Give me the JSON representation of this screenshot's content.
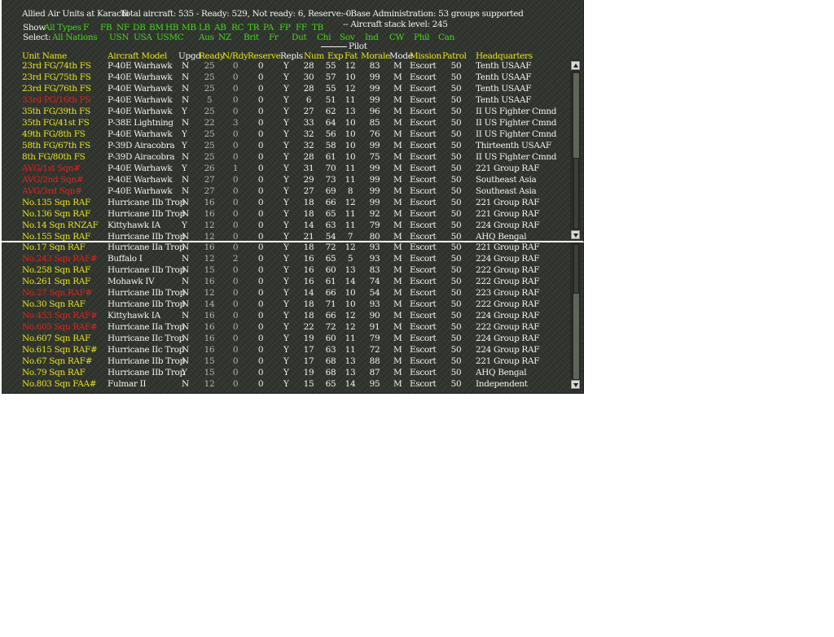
{
  "summary": {
    "title": "Allied Air Units at Karachi",
    "totals": "Total aircraft: 535 - Ready: 529, Not ready: 6, Reserve: 0",
    "base_admin": "-- Base Administration: 53 groups supported",
    "stack_level": "-- Aircraft stack level: 245"
  },
  "filters": {
    "show_label": "Show",
    "all_types": "All Types",
    "types": [
      "F",
      "FB",
      "NF",
      "DB",
      "BM",
      "HB",
      "MB",
      "LB",
      "AB",
      "RC",
      "TR",
      "PA",
      "FP",
      "FF",
      "TB"
    ],
    "select_label": "Select:",
    "all_nations": "All Nations",
    "nations": [
      "USN",
      "USA",
      "USMC",
      "Aus",
      "NZ",
      "Brit",
      "Fr",
      "Dut",
      "Chi",
      "Sov",
      "Ind",
      "CW",
      "Phil",
      "Can"
    ]
  },
  "headers": {
    "pilot": "Pilot",
    "unit": "Unit Name",
    "model": "Aircraft Model",
    "upgd": "Upgd",
    "ready": "Ready",
    "nrdy": "N/Rdy",
    "reserve": "Reserve",
    "repls": "Repls",
    "num": "Num",
    "exp": "Exp",
    "fat": "Fat",
    "morale": "Morale",
    "mode": "Mode",
    "mission": "Mission",
    "patrol": "Patrol",
    "hq": "Headquarters"
  },
  "colors": {
    "panel_bg": "#2f332c",
    "text_white": "#f2f2f2",
    "text_green": "#42d81a",
    "text_yellow": "#e7e41d",
    "text_red": "#e8201c"
  },
  "rows_top": [
    {
      "unit": "23rd FG/74th FS",
      "color": "yellow",
      "model": "P-40E Warhawk",
      "upgd": "N",
      "ready": "25",
      "nrdy": "0",
      "reserve": "0",
      "repls": "Y",
      "num": "28",
      "exp": "55",
      "fat": "12",
      "morale": "83",
      "mode": "M",
      "mission": "Escort",
      "patrol": "50",
      "hq": "Tenth USAAF"
    },
    {
      "unit": "23rd FG/75th FS",
      "color": "yellow",
      "model": "P-40E Warhawk",
      "upgd": "N",
      "ready": "25",
      "nrdy": "0",
      "reserve": "0",
      "repls": "Y",
      "num": "30",
      "exp": "57",
      "fat": "10",
      "morale": "99",
      "mode": "M",
      "mission": "Escort",
      "patrol": "50",
      "hq": "Tenth USAAF"
    },
    {
      "unit": "23rd FG/76th FS",
      "color": "yellow",
      "model": "P-40E Warhawk",
      "upgd": "N",
      "ready": "25",
      "nrdy": "0",
      "reserve": "0",
      "repls": "Y",
      "num": "28",
      "exp": "55",
      "fat": "12",
      "morale": "99",
      "mode": "M",
      "mission": "Escort",
      "patrol": "50",
      "hq": "Tenth USAAF"
    },
    {
      "unit": "33rd PG/16th FS",
      "color": "red",
      "model": "P-40E Warhawk",
      "upgd": "N",
      "ready": "5",
      "nrdy": "0",
      "reserve": "0",
      "repls": "Y",
      "num": "6",
      "exp": "51",
      "fat": "11",
      "morale": "99",
      "mode": "M",
      "mission": "Escort",
      "patrol": "50",
      "hq": "Tenth USAAF"
    },
    {
      "unit": "35th FG/39th FS",
      "color": "yellow",
      "model": "P-40E Warhawk",
      "upgd": "Y",
      "ready": "25",
      "nrdy": "0",
      "reserve": "0",
      "repls": "Y",
      "num": "27",
      "exp": "62",
      "fat": "13",
      "morale": "96",
      "mode": "M",
      "mission": "Escort",
      "patrol": "50",
      "hq": "II US Fighter Cmnd"
    },
    {
      "unit": "35th FG/41st FS",
      "color": "yellow",
      "model": "P-38E Lightning",
      "upgd": "N",
      "ready": "22",
      "nrdy": "3",
      "reserve": "0",
      "repls": "Y",
      "num": "33",
      "exp": "64",
      "fat": "10",
      "morale": "85",
      "mode": "M",
      "mission": "Escort",
      "patrol": "50",
      "hq": "II US Fighter Cmnd"
    },
    {
      "unit": "49th FG/8th FS",
      "color": "yellow",
      "model": "P-40E Warhawk",
      "upgd": "Y",
      "ready": "25",
      "nrdy": "0",
      "reserve": "0",
      "repls": "Y",
      "num": "32",
      "exp": "56",
      "fat": "10",
      "morale": "76",
      "mode": "M",
      "mission": "Escort",
      "patrol": "50",
      "hq": "II US Fighter Cmnd"
    },
    {
      "unit": "58th FG/67th FS",
      "color": "yellow",
      "model": "P-39D Airacobra",
      "upgd": "Y",
      "ready": "25",
      "nrdy": "0",
      "reserve": "0",
      "repls": "Y",
      "num": "32",
      "exp": "58",
      "fat": "10",
      "morale": "99",
      "mode": "M",
      "mission": "Escort",
      "patrol": "50",
      "hq": "Thirteenth USAAF"
    },
    {
      "unit": "8th FG/80th FS",
      "color": "yellow",
      "model": "P-39D Airacobra",
      "upgd": "N",
      "ready": "25",
      "nrdy": "0",
      "reserve": "0",
      "repls": "Y",
      "num": "28",
      "exp": "61",
      "fat": "10",
      "morale": "75",
      "mode": "M",
      "mission": "Escort",
      "patrol": "50",
      "hq": "II US Fighter Cmnd"
    },
    {
      "unit": "AVG/1st Sqn#",
      "color": "red",
      "model": "P-40E Warhawk",
      "upgd": "Y",
      "ready": "26",
      "nrdy": "1",
      "reserve": "0",
      "repls": "Y",
      "num": "31",
      "exp": "70",
      "fat": "11",
      "morale": "99",
      "mode": "M",
      "mission": "Escort",
      "patrol": "50",
      "hq": "221 Group RAF"
    },
    {
      "unit": "AVG/2nd Sqn#",
      "color": "red",
      "model": "P-40E Warhawk",
      "upgd": "N",
      "ready": "27",
      "nrdy": "0",
      "reserve": "0",
      "repls": "Y",
      "num": "29",
      "exp": "73",
      "fat": "11",
      "morale": "99",
      "mode": "M",
      "mission": "Escort",
      "patrol": "50",
      "hq": "Southeast Asia"
    },
    {
      "unit": "AVG/3rd Sqn#",
      "color": "red",
      "model": "P-40E Warhawk",
      "upgd": "N",
      "ready": "27",
      "nrdy": "0",
      "reserve": "0",
      "repls": "Y",
      "num": "27",
      "exp": "69",
      "fat": "8",
      "morale": "99",
      "mode": "M",
      "mission": "Escort",
      "patrol": "50",
      "hq": "Southeast Asia"
    },
    {
      "unit": "No.135 Sqn RAF",
      "color": "yellow",
      "model": "Hurricane IIb Trop",
      "upgd": "N",
      "ready": "16",
      "nrdy": "0",
      "reserve": "0",
      "repls": "Y",
      "num": "18",
      "exp": "66",
      "fat": "12",
      "morale": "99",
      "mode": "M",
      "mission": "Escort",
      "patrol": "50",
      "hq": "221 Group RAF"
    },
    {
      "unit": "No.136 Sqn RAF",
      "color": "yellow",
      "model": "Hurricane IIb Trop",
      "upgd": "N",
      "ready": "16",
      "nrdy": "0",
      "reserve": "0",
      "repls": "Y",
      "num": "18",
      "exp": "65",
      "fat": "11",
      "morale": "92",
      "mode": "M",
      "mission": "Escort",
      "patrol": "50",
      "hq": "221 Group RAF"
    },
    {
      "unit": "No.14 Sqn RNZAF",
      "color": "yellow",
      "model": "Kittyhawk IA",
      "upgd": "Y",
      "ready": "12",
      "nrdy": "0",
      "reserve": "0",
      "repls": "Y",
      "num": "14",
      "exp": "63",
      "fat": "11",
      "morale": "79",
      "mode": "M",
      "mission": "Escort",
      "patrol": "50",
      "hq": "224 Group RAF"
    },
    {
      "unit": "No.155 Sqn RAF",
      "color": "yellow",
      "model": "Hurricane IIb Trop",
      "upgd": "N",
      "ready": "12",
      "nrdy": "0",
      "reserve": "0",
      "repls": "Y",
      "num": "21",
      "exp": "54",
      "fat": "7",
      "morale": "80",
      "mode": "M",
      "mission": "Escort",
      "patrol": "50",
      "hq": "AHQ Bengal"
    }
  ],
  "rows_bottom": [
    {
      "unit": "No.17 Sqn RAF",
      "color": "yellow",
      "model": "Hurricane IIa Trop",
      "upgd": "N",
      "ready": "16",
      "nrdy": "0",
      "reserve": "0",
      "repls": "Y",
      "num": "18",
      "exp": "72",
      "fat": "12",
      "morale": "93",
      "mode": "M",
      "mission": "Escort",
      "patrol": "50",
      "hq": "221 Group RAF"
    },
    {
      "unit": "No.243 Sqn RAF#",
      "color": "red",
      "model": "Buffalo I",
      "upgd": "N",
      "ready": "12",
      "nrdy": "2",
      "reserve": "0",
      "repls": "Y",
      "num": "16",
      "exp": "65",
      "fat": "5",
      "morale": "93",
      "mode": "M",
      "mission": "Escort",
      "patrol": "50",
      "hq": "224 Group RAF"
    },
    {
      "unit": "No.258 Sqn RAF",
      "color": "yellow",
      "model": "Hurricane IIb Trop",
      "upgd": "N",
      "ready": "15",
      "nrdy": "0",
      "reserve": "0",
      "repls": "Y",
      "num": "16",
      "exp": "60",
      "fat": "13",
      "morale": "83",
      "mode": "M",
      "mission": "Escort",
      "patrol": "50",
      "hq": "222 Group RAF"
    },
    {
      "unit": "No.261 Sqn RAF",
      "color": "yellow",
      "model": "Mohawk IV",
      "upgd": "N",
      "ready": "16",
      "nrdy": "0",
      "reserve": "0",
      "repls": "Y",
      "num": "16",
      "exp": "61",
      "fat": "14",
      "morale": "74",
      "mode": "M",
      "mission": "Escort",
      "patrol": "50",
      "hq": "222 Group RAF"
    },
    {
      "unit": "No.27 Sqn RAF#",
      "color": "red",
      "model": "Hurricane IIb Trop",
      "upgd": "N",
      "ready": "12",
      "nrdy": "0",
      "reserve": "0",
      "repls": "Y",
      "num": "14",
      "exp": "66",
      "fat": "10",
      "morale": "54",
      "mode": "M",
      "mission": "Escort",
      "patrol": "50",
      "hq": "223 Group RAF"
    },
    {
      "unit": "No.30 Sqn RAF",
      "color": "yellow",
      "model": "Hurricane IIb Trop",
      "upgd": "N",
      "ready": "14",
      "nrdy": "0",
      "reserve": "0",
      "repls": "Y",
      "num": "18",
      "exp": "71",
      "fat": "10",
      "morale": "93",
      "mode": "M",
      "mission": "Escort",
      "patrol": "50",
      "hq": "222 Group RAF"
    },
    {
      "unit": "No.453 Sqn RAF#",
      "color": "red",
      "model": "Kittyhawk IA",
      "upgd": "N",
      "ready": "16",
      "nrdy": "0",
      "reserve": "0",
      "repls": "Y",
      "num": "18",
      "exp": "66",
      "fat": "12",
      "morale": "90",
      "mode": "M",
      "mission": "Escort",
      "patrol": "50",
      "hq": "224 Group RAF"
    },
    {
      "unit": "No.605 Sqn RAF#",
      "color": "red",
      "model": "Hurricane IIa Trop",
      "upgd": "N",
      "ready": "16",
      "nrdy": "0",
      "reserve": "0",
      "repls": "Y",
      "num": "22",
      "exp": "72",
      "fat": "12",
      "morale": "91",
      "mode": "M",
      "mission": "Escort",
      "patrol": "50",
      "hq": "222 Group RAF"
    },
    {
      "unit": "No.607 Sqn RAF",
      "color": "yellow",
      "model": "Hurricane IIc Trop",
      "upgd": "N",
      "ready": "16",
      "nrdy": "0",
      "reserve": "0",
      "repls": "Y",
      "num": "19",
      "exp": "60",
      "fat": "11",
      "morale": "79",
      "mode": "M",
      "mission": "Escort",
      "patrol": "50",
      "hq": "224 Group RAF"
    },
    {
      "unit": "No.615 Sqn RAF#",
      "color": "yellow",
      "model": "Hurricane IIc Trop",
      "upgd": "N",
      "ready": "16",
      "nrdy": "0",
      "reserve": "0",
      "repls": "Y",
      "num": "17",
      "exp": "63",
      "fat": "11",
      "morale": "72",
      "mode": "M",
      "mission": "Escort",
      "patrol": "50",
      "hq": "224 Group RAF"
    },
    {
      "unit": "No.67 Sqn RAF#",
      "color": "yellow",
      "model": "Hurricane IIb Trop",
      "upgd": "N",
      "ready": "15",
      "nrdy": "0",
      "reserve": "0",
      "repls": "Y",
      "num": "17",
      "exp": "68",
      "fat": "13",
      "morale": "88",
      "mode": "M",
      "mission": "Escort",
      "patrol": "50",
      "hq": "221 Group RAF"
    },
    {
      "unit": "No.79 Sqn RAF",
      "color": "yellow",
      "model": "Hurricane IIb Trop",
      "upgd": "Y",
      "ready": "15",
      "nrdy": "0",
      "reserve": "0",
      "repls": "Y",
      "num": "19",
      "exp": "68",
      "fat": "13",
      "morale": "87",
      "mode": "M",
      "mission": "Escort",
      "patrol": "50",
      "hq": "AHQ Bengal"
    },
    {
      "unit": "No.803 Sqn FAA#",
      "color": "yellow",
      "model": "Fulmar II",
      "upgd": "N",
      "ready": "12",
      "nrdy": "0",
      "reserve": "0",
      "repls": "Y",
      "num": "15",
      "exp": "65",
      "fat": "14",
      "morale": "95",
      "mode": "M",
      "mission": "Escort",
      "patrol": "50",
      "hq": "Independent"
    }
  ]
}
